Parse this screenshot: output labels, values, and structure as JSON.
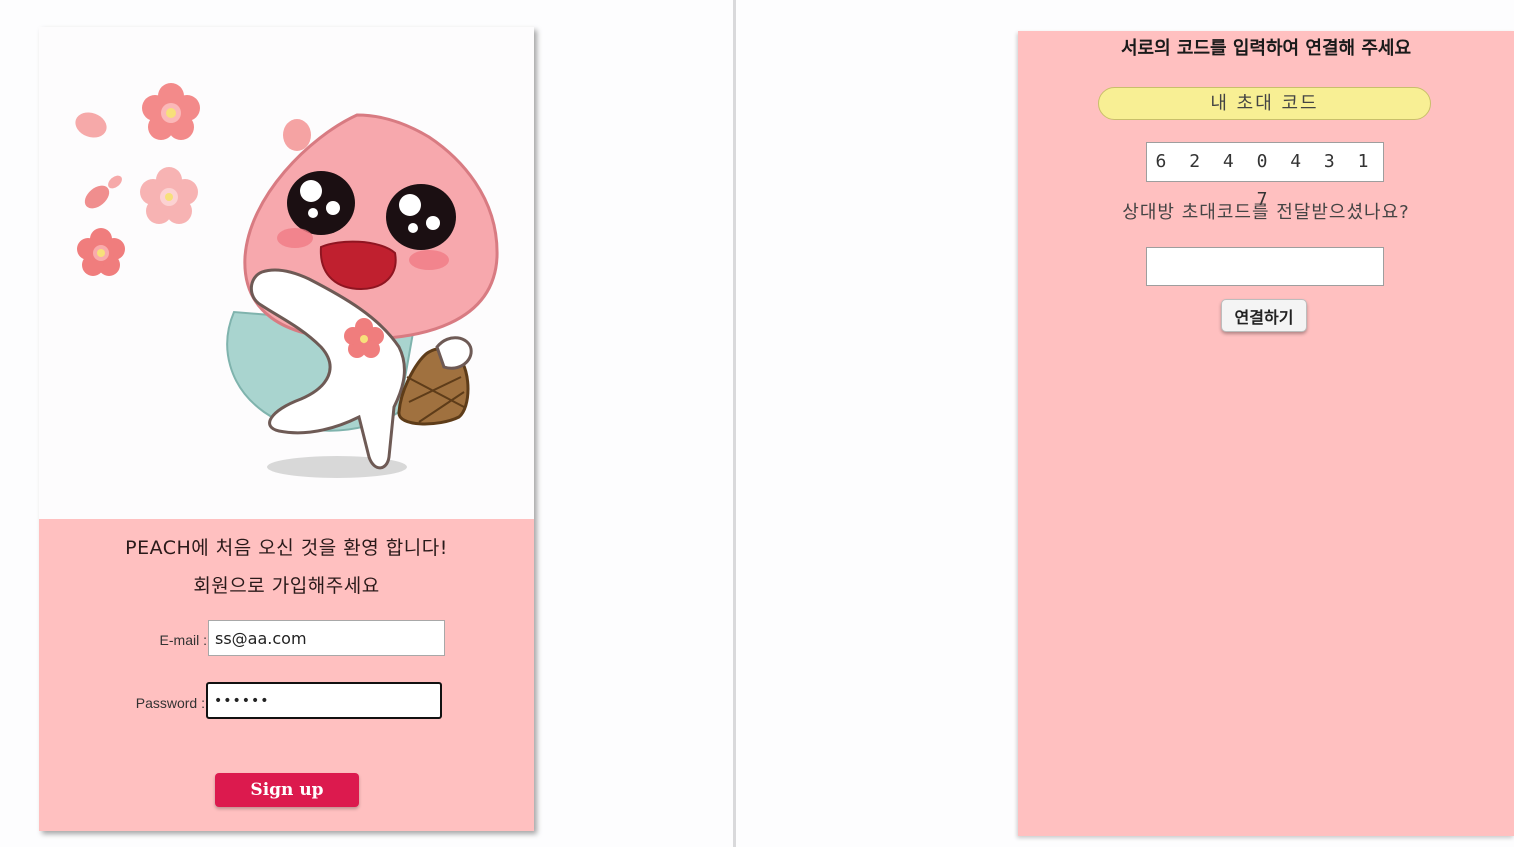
{
  "signup": {
    "welcome_line1": "PEACH에 처음 오신 것을 환영 합니다!",
    "welcome_line2": "회원으로 가입해주세요",
    "email_label": "E-mail :",
    "email_value": "ss@aa.com",
    "password_label": "Password :",
    "password_value": "••••••",
    "signup_button": "Sign up",
    "illustration_icon": "peach-character-illustration"
  },
  "connect": {
    "title": "서로의 코드를 입력하여 연결해 주세요",
    "my_code_label": "내 초대 코드",
    "my_code_value": "6 2 4 0 4 3 1 7",
    "ask_text": "상대방 초대코드를 전달받으셨나요?",
    "partner_code_value": "",
    "connect_button": "연결하기"
  },
  "colors": {
    "panel_pink": "#ffc0c0",
    "signup_red": "#dc1a4e",
    "pill_yellow": "#f8ef94"
  }
}
